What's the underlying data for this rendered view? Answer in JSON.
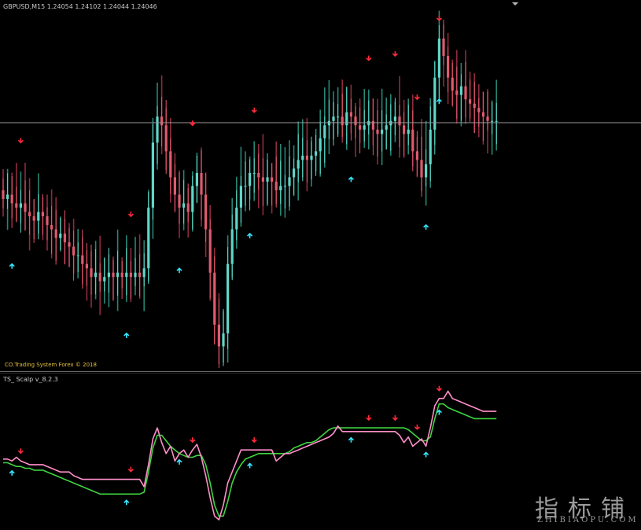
{
  "window": {
    "symbol_line": "GBPUSD,M15  1.24054 1.24102 1.24044 1.24046",
    "copyright": "CO.Trading System Forex © 2018"
  },
  "indicator": {
    "title": "TS_ Scalp v_8.2.3"
  },
  "watermark": {
    "chinese": "指标铺",
    "latin": "ZHIBIAOPU.COM"
  },
  "colors": {
    "background": "#000000",
    "bull_candle": "#5fd6c8",
    "bear_candle": "#e05a6e",
    "band_bull": "#2e9c8a",
    "band_bear": "#a8324a",
    "signal_down": "#ff2a3c",
    "signal_up": "#33e8ff",
    "line_green": "#3fd33f",
    "line_pink": "#ff8fc8",
    "price_line": "#9a9a9a",
    "separator": "#6a6a6a"
  },
  "chart_data": [
    {
      "type": "candlestick",
      "symbol": "GBPUSD",
      "timeframe": "M15",
      "ohlc_last": [
        1.24054,
        1.24102,
        1.24044,
        1.24046
      ],
      "price_line": 1.24046,
      "ylim": [
        1.2348,
        1.243
      ],
      "close": [
        1.2387,
        1.2388,
        1.2386,
        1.2385,
        1.2386,
        1.2384,
        1.2383,
        1.2382,
        1.2384,
        1.2383,
        1.2381,
        1.238,
        1.2378,
        1.2379,
        1.2377,
        1.2376,
        1.2374,
        1.2374,
        1.2372,
        1.2371,
        1.2369,
        1.237,
        1.2368,
        1.2369,
        1.237,
        1.2369,
        1.237,
        1.2369,
        1.237,
        1.2369,
        1.237,
        1.2369,
        1.2371,
        1.2385,
        1.24,
        1.2406,
        1.2404,
        1.2398,
        1.2392,
        1.2388,
        1.2385,
        1.2386,
        1.2384,
        1.239,
        1.2393,
        1.2388,
        1.238,
        1.237,
        1.2358,
        1.2353,
        1.2356,
        1.2372,
        1.238,
        1.2385,
        1.239,
        1.239,
        1.2393,
        1.2393,
        1.2392,
        1.2391,
        1.2392,
        1.2391,
        1.2389,
        1.239,
        1.239,
        1.2392,
        1.2394,
        1.2396,
        1.2397,
        1.2396,
        1.2397,
        1.2398,
        1.2401,
        1.2404,
        1.2405,
        1.2406,
        1.2406,
        1.2404,
        1.2407,
        1.2406,
        1.2404,
        1.2403,
        1.2404,
        1.2405,
        1.2403,
        1.2402,
        1.2403,
        1.2404,
        1.2405,
        1.2406,
        1.2404,
        1.2402,
        1.2403,
        1.2398,
        1.2396,
        1.2392,
        1.2395,
        1.2403,
        1.2415,
        1.2424,
        1.242,
        1.2415,
        1.2412,
        1.2411,
        1.2413,
        1.241,
        1.2409,
        1.2408,
        1.2407,
        1.2406,
        1.2405,
        1.2405,
        1.2405
      ],
      "signals_up": [
        2,
        28,
        40,
        56,
        79,
        96,
        99
      ],
      "signals_down": [
        4,
        29,
        43,
        57,
        83,
        89,
        94,
        99
      ]
    },
    {
      "type": "line",
      "title": "TS_ Scalp v_8.2.3",
      "series": [
        {
          "name": "",
          "color": "#3fd33f",
          "values": [
            1.2385,
            1.2385,
            1.2384,
            1.2383,
            1.2383,
            1.2382,
            1.2382,
            1.2381,
            1.2381,
            1.2381,
            1.238,
            1.2379,
            1.2378,
            1.2377,
            1.2376,
            1.2375,
            1.2374,
            1.2373,
            1.2372,
            1.2371,
            1.237,
            1.2369,
            1.2368,
            1.2368,
            1.2368,
            1.2368,
            1.2368,
            1.2368,
            1.2368,
            1.2368,
            1.2368,
            1.2368,
            1.2369,
            1.238,
            1.2393,
            1.24,
            1.24,
            1.2397,
            1.2394,
            1.2392,
            1.239,
            1.2389,
            1.2388,
            1.2388,
            1.2389,
            1.2389,
            1.2384,
            1.2374,
            1.2362,
            1.2356,
            1.2356,
            1.2364,
            1.2374,
            1.238,
            1.2384,
            1.2387,
            1.2388,
            1.2389,
            1.239,
            1.239,
            1.239,
            1.239,
            1.239,
            1.239,
            1.239,
            1.2391,
            1.2393,
            1.2394,
            1.2395,
            1.2396,
            1.2396,
            1.2397,
            1.2399,
            1.2401,
            1.2403,
            1.2404,
            1.2404,
            1.2404,
            1.2404,
            1.2404,
            1.2404,
            1.2404,
            1.2404,
            1.2404,
            1.2404,
            1.2404,
            1.2404,
            1.2404,
            1.2404,
            1.2404,
            1.2404,
            1.2404,
            1.2403,
            1.2401,
            1.2399,
            1.2397,
            1.2397,
            1.2399,
            1.2409,
            1.2417,
            1.2417,
            1.2415,
            1.2414,
            1.2413,
            1.2412,
            1.2411,
            1.241,
            1.2409,
            1.2409,
            1.2409,
            1.2409,
            1.2409,
            1.2409
          ]
        },
        {
          "name": "",
          "color": "#ff8fc8",
          "values": [
            1.2387,
            1.2387,
            1.2386,
            1.2388,
            1.2386,
            1.2385,
            1.2384,
            1.2384,
            1.2384,
            1.2384,
            1.2383,
            1.2382,
            1.2381,
            1.238,
            1.238,
            1.238,
            1.2378,
            1.2377,
            1.2376,
            1.2376,
            1.2376,
            1.2376,
            1.2376,
            1.2376,
            1.2376,
            1.2376,
            1.2376,
            1.2376,
            1.2376,
            1.2376,
            1.2376,
            1.2376,
            1.2372,
            1.2384,
            1.2398,
            1.2404,
            1.2396,
            1.239,
            1.2394,
            1.2386,
            1.239,
            1.2392,
            1.2388,
            1.2392,
            1.2395,
            1.2388,
            1.2378,
            1.2366,
            1.2356,
            1.2354,
            1.2362,
            1.2374,
            1.238,
            1.2386,
            1.2392,
            1.2392,
            1.2392,
            1.2392,
            1.2392,
            1.2392,
            1.2392,
            1.2392,
            1.2386,
            1.2388,
            1.239,
            1.239,
            1.2391,
            1.2392,
            1.2393,
            1.2394,
            1.2395,
            1.2396,
            1.2397,
            1.2398,
            1.2399,
            1.2401,
            1.2405,
            1.2402,
            1.2402,
            1.2402,
            1.2402,
            1.2402,
            1.2402,
            1.2402,
            1.2402,
            1.2402,
            1.2402,
            1.2402,
            1.2402,
            1.2402,
            1.24,
            1.2396,
            1.2399,
            1.2394,
            1.2396,
            1.2398,
            1.2394,
            1.2404,
            1.2416,
            1.242,
            1.242,
            1.2424,
            1.242,
            1.2419,
            1.2418,
            1.2417,
            1.2416,
            1.2415,
            1.2414,
            1.2413,
            1.2413,
            1.2413,
            1.2413
          ]
        }
      ],
      "signals_up": [
        2,
        28,
        40,
        56,
        79,
        96,
        99
      ],
      "signals_down": [
        4,
        29,
        43,
        57,
        83,
        89,
        94,
        99
      ]
    }
  ]
}
